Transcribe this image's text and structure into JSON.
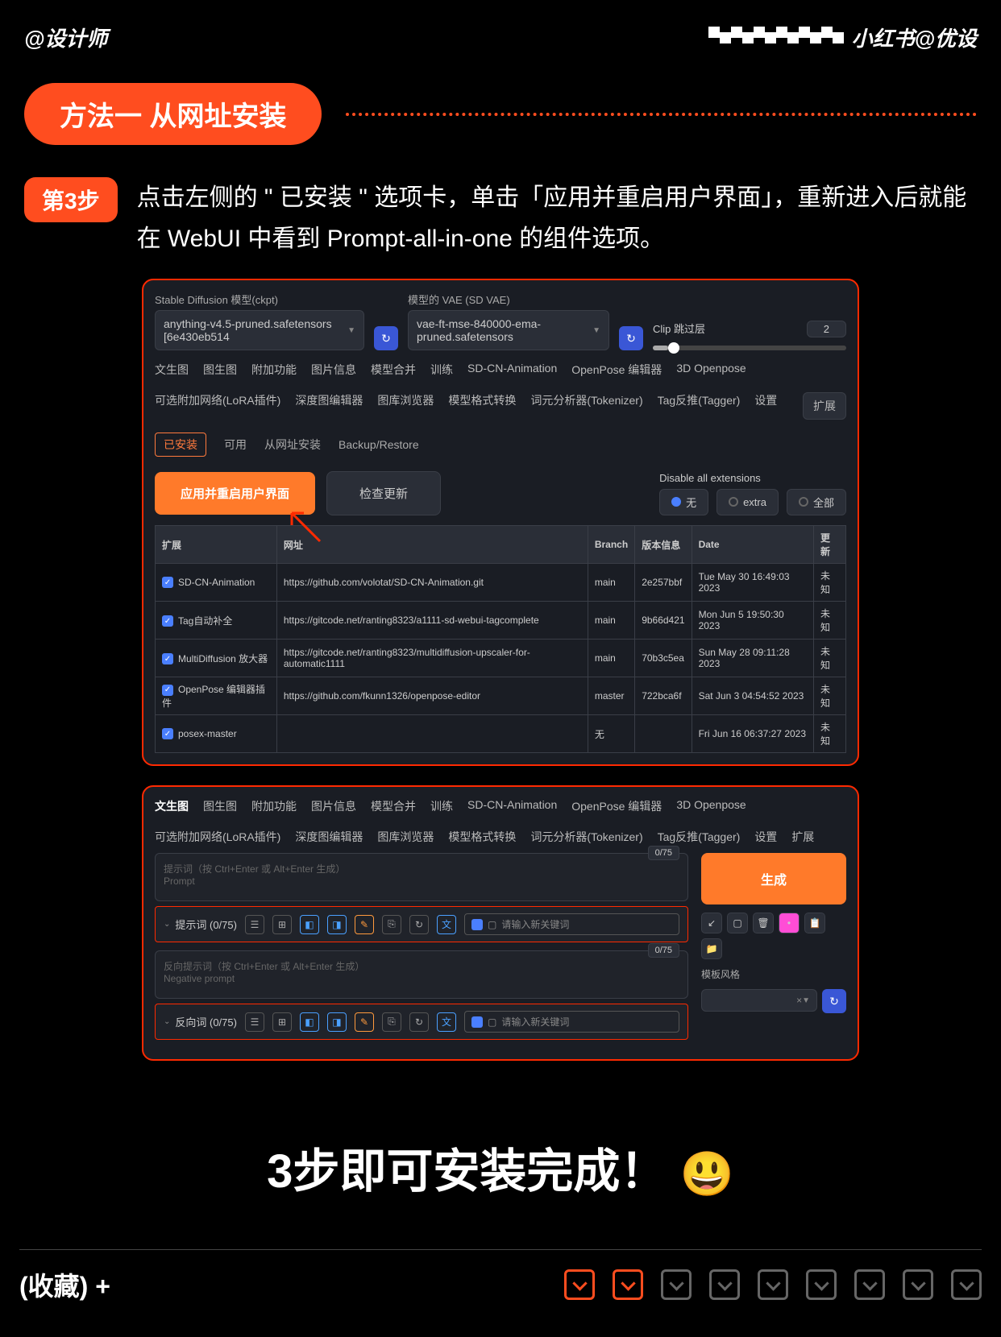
{
  "header": {
    "left": "@设计师",
    "right": "小红书@优设"
  },
  "method": {
    "pill": "方法一 从网址安装",
    "step_badge": "第3步",
    "step_text": "点击左侧的 \" 已安装 \" 选项卡，单击「应用并重启用户界面」，重新进入后就能在 WebUI 中看到 Prompt-all-in-one 的组件选项。"
  },
  "panel1": {
    "ckpt_label": "Stable Diffusion 模型(ckpt)",
    "ckpt_value": "anything-v4.5-pruned.safetensors [6e430eb514",
    "vae_label": "模型的 VAE (SD VAE)",
    "vae_value": "vae-ft-mse-840000-ema-pruned.safetensors",
    "clip_label": "Clip 跳过层",
    "clip_value": "2",
    "tabs": [
      "文生图",
      "图生图",
      "附加功能",
      "图片信息",
      "模型合并",
      "训练",
      "SD-CN-Animation",
      "OpenPose 编辑器",
      "3D Openpose",
      "可选附加网络(LoRA插件)",
      "深度图编辑器",
      "图库浏览器",
      "模型格式转换",
      "词元分析器(Tokenizer)",
      "Tag反推(Tagger)",
      "设置"
    ],
    "tab_active": "扩展",
    "subtabs": {
      "installed": "已安装",
      "available": "可用",
      "from_url": "从网址安装",
      "backup": "Backup/Restore"
    },
    "apply_btn": "应用并重启用户界面",
    "check_btn": "检查更新",
    "disable_label": "Disable all extensions",
    "radio": {
      "none": "无",
      "extra": "extra",
      "all": "全部"
    },
    "cols": {
      "ext": "扩展",
      "url": "网址",
      "branch": "Branch",
      "ver": "版本信息",
      "date": "Date",
      "upd": "更新"
    },
    "rows": [
      {
        "ext": "SD-CN-Animation",
        "url": "https://github.com/volotat/SD-CN-Animation.git",
        "branch": "main",
        "ver": "2e257bbf",
        "date": "Tue May 30 16:49:03 2023",
        "upd": "未知"
      },
      {
        "ext": "Tag自动补全",
        "url": "https://gitcode.net/ranting8323/a1111-sd-webui-tagcomplete",
        "branch": "main",
        "ver": "9b66d421",
        "date": "Mon Jun 5 19:50:30 2023",
        "upd": "未知"
      },
      {
        "ext": "MultiDiffusion 放大器",
        "url": "https://gitcode.net/ranting8323/multidiffusion-upscaler-for-automatic1111",
        "branch": "main",
        "ver": "70b3c5ea",
        "date": "Sun May 28 09:11:28 2023",
        "upd": "未知"
      },
      {
        "ext": "OpenPose 编辑器插件",
        "url": "https://github.com/fkunn1326/openpose-editor",
        "branch": "master",
        "ver": "722bca6f",
        "date": "Sat Jun 3 04:54:52 2023",
        "upd": "未知"
      },
      {
        "ext": "posex-master",
        "url": "",
        "branch": "无",
        "ver": "",
        "date": "Fri Jun 16 06:37:27 2023",
        "upd": "未知"
      }
    ]
  },
  "panel2": {
    "tabs": [
      "文生图",
      "图生图",
      "附加功能",
      "图片信息",
      "模型合并",
      "训练",
      "SD-CN-Animation",
      "OpenPose 编辑器",
      "3D Openpose",
      "可选附加网络(LoRA插件)",
      "深度图编辑器",
      "图库浏览器",
      "模型格式转换",
      "词元分析器(Tokenizer)",
      "Tag反推(Tagger)",
      "设置",
      "扩展"
    ],
    "counter": "0/75",
    "prompt_hint1": "提示词（按 Ctrl+Enter 或 Alt+Enter 生成）",
    "prompt_hint2": "Prompt",
    "prompt_bar": "提示词 (0/75)",
    "neg_hint1": "反向提示词（按 Ctrl+Enter 或 Alt+Enter 生成）",
    "neg_hint2": "Negative prompt",
    "neg_bar": "反向词 (0/75)",
    "kw_placeholder": "请输入新关键词",
    "gen": "生成",
    "style_label": "模板风格"
  },
  "done": "3步即可安装完成！",
  "fav": "(收藏) +"
}
